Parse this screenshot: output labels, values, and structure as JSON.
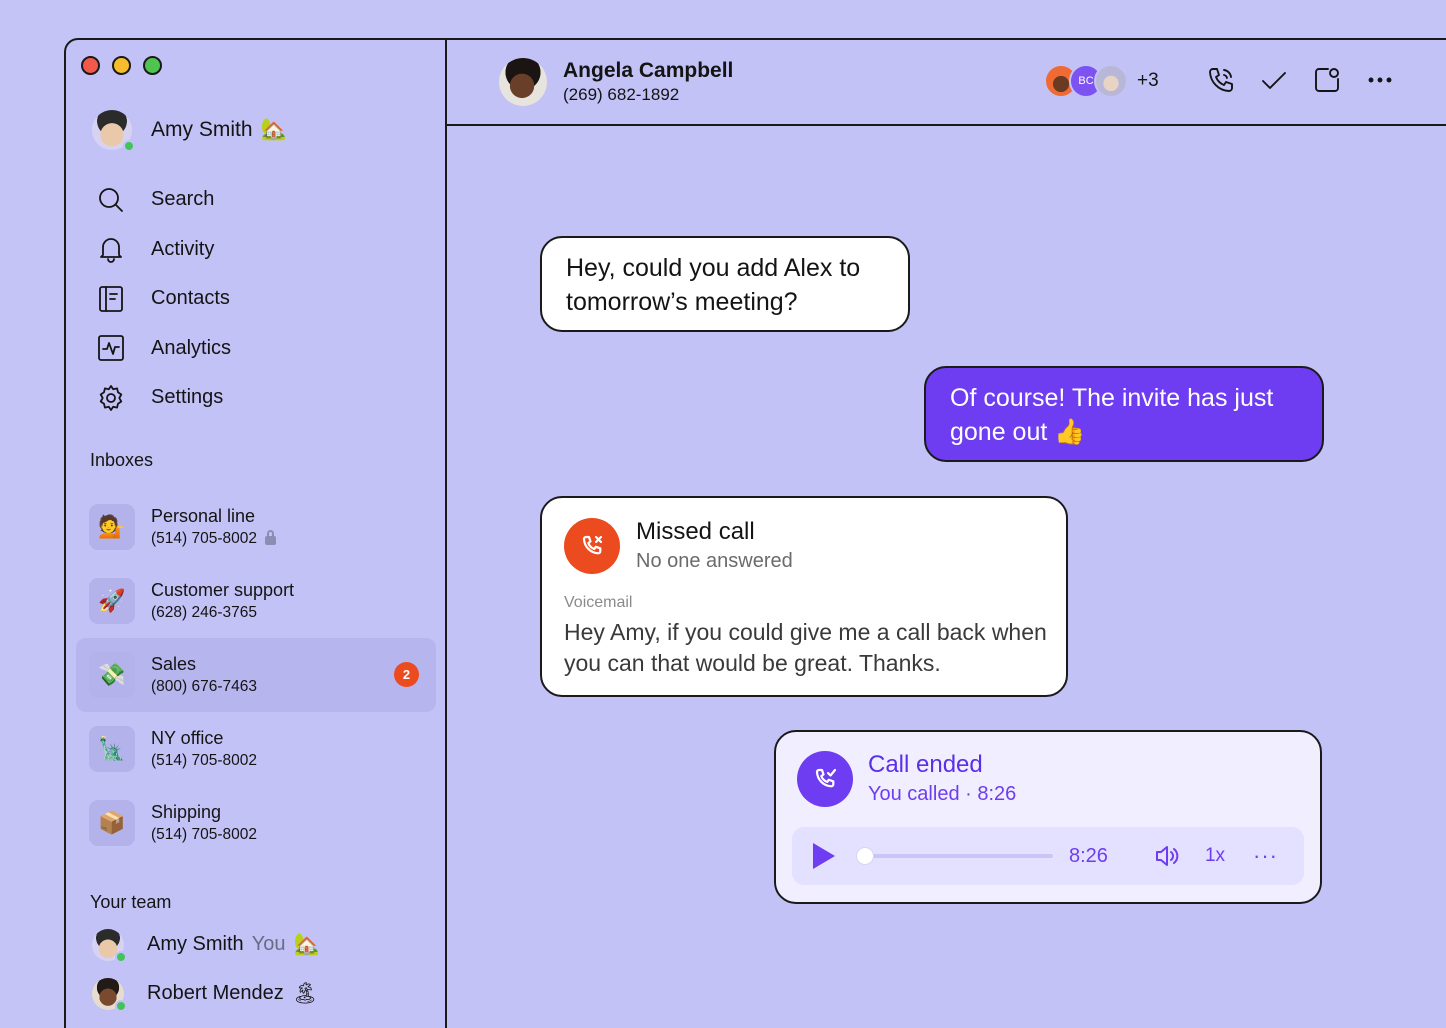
{
  "user": {
    "name": "Amy Smith",
    "status_emoji": "🏡"
  },
  "nav": [
    {
      "label": "Search",
      "icon": "search-icon"
    },
    {
      "label": "Activity",
      "icon": "bell-icon"
    },
    {
      "label": "Contacts",
      "icon": "contacts-book-icon"
    },
    {
      "label": "Analytics",
      "icon": "analytics-icon"
    },
    {
      "label": "Settings",
      "icon": "gear-icon"
    }
  ],
  "inboxes_title": "Inboxes",
  "inboxes": [
    {
      "name": "Personal line",
      "number": "(514) 705-8002",
      "emoji": "💁",
      "locked": true
    },
    {
      "name": "Customer support",
      "number": "(628) 246-3765",
      "emoji": "🚀"
    },
    {
      "name": "Sales",
      "number": "(800) 676-7463",
      "emoji": "💸",
      "unread": "2",
      "active": true
    },
    {
      "name": "NY office",
      "number": "(514) 705-8002",
      "emoji": "🗽"
    },
    {
      "name": "Shipping",
      "number": "(514) 705-8002",
      "emoji": "📦"
    }
  ],
  "team_title": "Your team",
  "team": [
    {
      "name": "Amy Smith",
      "suffix": "You",
      "emoji": "🏡"
    },
    {
      "name": "Robert Mendez",
      "emoji": "🏝"
    }
  ],
  "conversation": {
    "name": "Angela Campbell",
    "phone": "(269) 682-1892",
    "participant_initials": "BC",
    "more_participants": "+3"
  },
  "messages": {
    "incoming": "Hey, could you add Alex to tomorrow’s meeting?",
    "outgoing": "Of course! The invite has just gone out 👍"
  },
  "missed_call": {
    "title": "Missed call",
    "subtitle": "No one answered",
    "voicemail_label": "Voicemail",
    "voicemail_text": "Hey Amy, if you could give me a call back when you can that would be great. Thanks."
  },
  "call_ended": {
    "title": "Call ended",
    "subtitle": "You called · 8:26",
    "duration": "8:26",
    "speed": "1x",
    "more": "···",
    "progress": 0
  },
  "colors": {
    "background": "#c5c4f7",
    "accent": "#6e3cf1",
    "missed": "#ec4a1f",
    "online": "#43c45a"
  }
}
